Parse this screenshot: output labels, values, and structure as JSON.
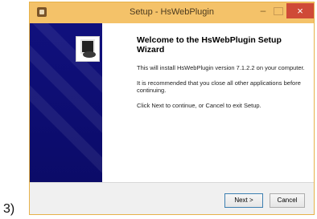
{
  "outer": {
    "label": "3)"
  },
  "window": {
    "title": "Setup - HsWebPlugin",
    "controls": {
      "minimize": "–",
      "close": "×"
    },
    "colors": {
      "titlebar": "#f4c269",
      "close": "#cf4a37",
      "banner": "#10107d"
    }
  },
  "wizard": {
    "title": "Welcome to the HsWebPlugin Setup Wizard",
    "paragraphs": [
      "This will install HsWebPlugin version 7.1.2.2 on your computer.",
      "It is recommended that you close all other applications before continuing.",
      "Click Next to continue, or Cancel to exit Setup."
    ]
  },
  "buttons": {
    "next": "Next >",
    "cancel": "Cancel"
  }
}
